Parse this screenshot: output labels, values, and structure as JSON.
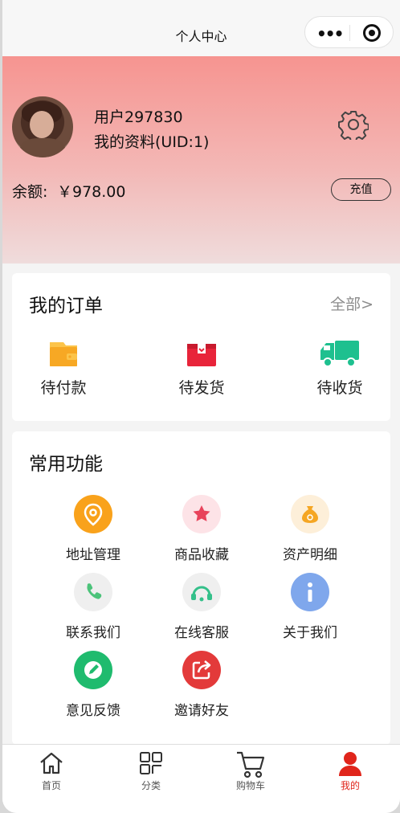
{
  "nav": {
    "title": "个人中心",
    "more_icon": "more-dots-icon",
    "close_icon": "capsule-close-icon"
  },
  "user": {
    "name": "用户297830",
    "profile": "我的资料(UID:1)",
    "avatar_icon": "avatar"
  },
  "balance": {
    "label": "余额:",
    "value": "￥978.00",
    "recharge_label": "充值"
  },
  "orders": {
    "title": "我的订单",
    "all_label": "全部>",
    "items": [
      {
        "label": "待付款",
        "icon": "wallet-icon",
        "color": "#f7a824"
      },
      {
        "label": "待发货",
        "icon": "package-icon",
        "color": "#e8243a"
      },
      {
        "label": "待收货",
        "icon": "truck-icon",
        "color": "#1ec08f"
      }
    ]
  },
  "functions": {
    "title": "常用功能",
    "items": [
      {
        "label": "地址管理",
        "icon": "location-icon",
        "color": "#f9a21b"
      },
      {
        "label": "商品收藏",
        "icon": "star-icon",
        "color": "#e8435b"
      },
      {
        "label": "资产明细",
        "icon": "money-bag-icon",
        "color": "#f5a623"
      },
      {
        "label": "联系我们",
        "icon": "phone-icon",
        "color": "#4cc37a"
      },
      {
        "label": "在线客服",
        "icon": "headset-icon",
        "color": "#34c08a"
      },
      {
        "label": "关于我们",
        "icon": "info-icon",
        "color": "#7fa7ec"
      },
      {
        "label": "意见反馈",
        "icon": "edit-icon",
        "color": "#1fbb6e"
      },
      {
        "label": "邀请好友",
        "icon": "share-icon",
        "color": "#e33a3a"
      }
    ]
  },
  "tabbar": {
    "items": [
      {
        "label": "首页",
        "icon": "home-icon"
      },
      {
        "label": "分类",
        "icon": "category-icon"
      },
      {
        "label": "购物车",
        "icon": "cart-icon"
      },
      {
        "label": "我的",
        "icon": "user-icon",
        "active": true
      }
    ],
    "active_color": "#e0251b"
  }
}
